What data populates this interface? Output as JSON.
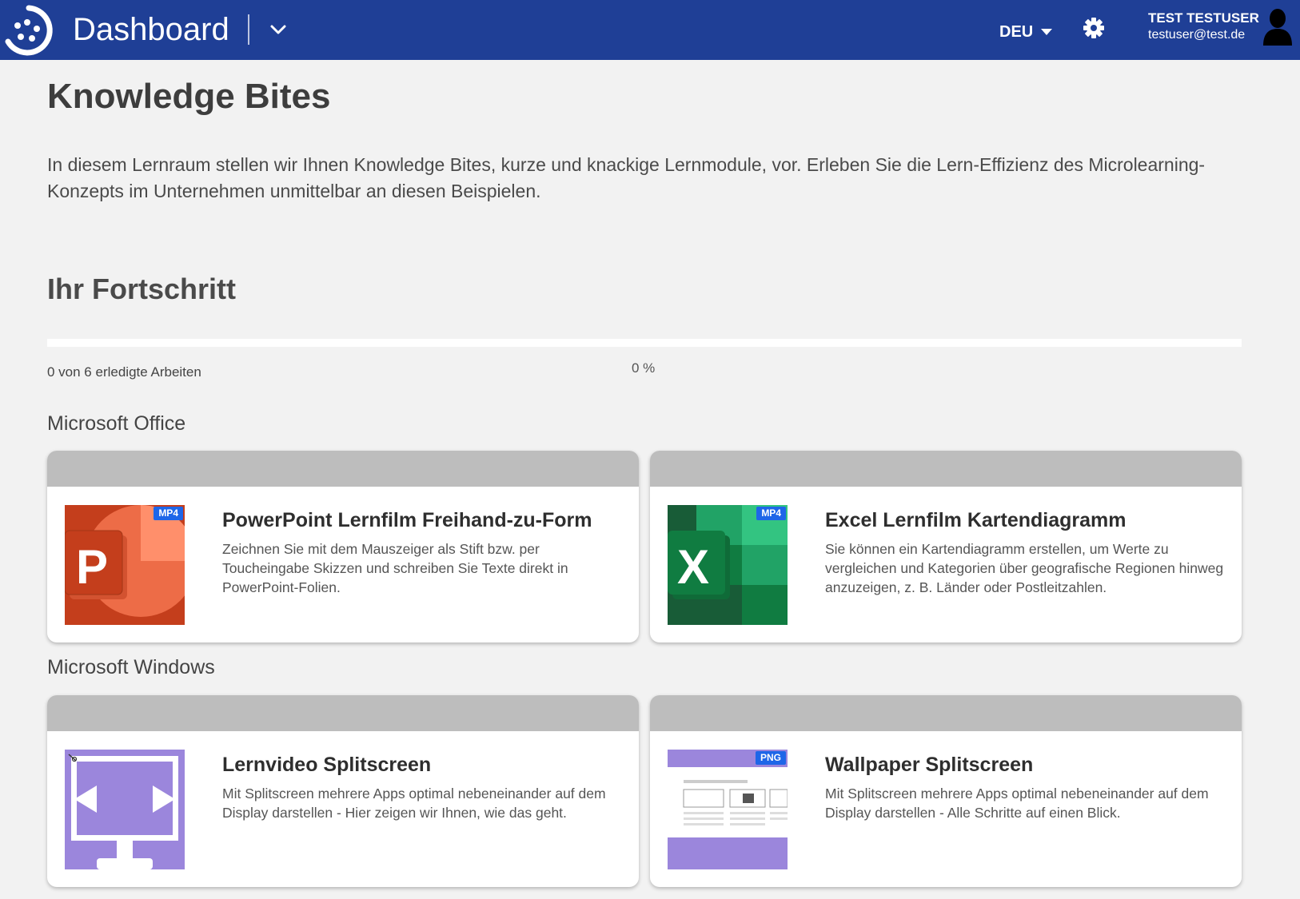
{
  "header": {
    "app_title": "Dashboard",
    "language": "DEU",
    "user_name": "TEST TESTUSER",
    "user_email": "testuser@test.de",
    "bar_color": "#1f3f96"
  },
  "page": {
    "title": "Knowledge Bites",
    "intro": "In diesem Lernraum stellen wir Ihnen Knowledge Bites, kurze und knackige Lernmodule, vor. Erleben Sie die Lern-Effizienz des Microlearning-Konzepts im Unternehmen unmittelbar an diesen Beispielen."
  },
  "progress": {
    "title": "Ihr Fortschritt",
    "count_text": "0 von 6 erledigte Arbeiten",
    "percent_text": "0 %",
    "value": 0
  },
  "sections": [
    {
      "title": "Microsoft Office",
      "cards": [
        {
          "title": "PowerPoint Lernfilm Freihand-zu-Form",
          "description": "Zeichnen Sie mit dem Mauszeiger als Stift bzw. per Toucheingabe Skizzen und schreiben Sie Texte direkt in PowerPoint-Folien.",
          "badge": "MP4",
          "icon": "powerpoint-icon"
        },
        {
          "title": "Excel Lernfilm Kartendiagramm",
          "description": "Sie können ein Kartendiagramm erstellen, um Werte zu vergleichen und Kategorien über geografische Regionen hinweg anzuzeigen, z. B. Länder oder Postleitzahlen.",
          "badge": "MP4",
          "icon": "excel-icon"
        }
      ]
    },
    {
      "title": "Microsoft Windows",
      "cards": [
        {
          "title": "Lernvideo Splitscreen",
          "description": "Mit Splitscreen mehrere Apps optimal nebeneinander auf dem Display darstellen - Hier zeigen wir Ihnen, wie das geht.",
          "badge": "",
          "icon": "monitor-splitscreen-icon"
        },
        {
          "title": "Wallpaper Splitscreen",
          "description": "Mit Splitscreen mehrere Apps optimal nebeneinander auf dem Display darstellen - Alle Schritte auf einen Blick.",
          "badge": "PNG",
          "icon": "wallpaper-thumbnail"
        }
      ]
    }
  ]
}
